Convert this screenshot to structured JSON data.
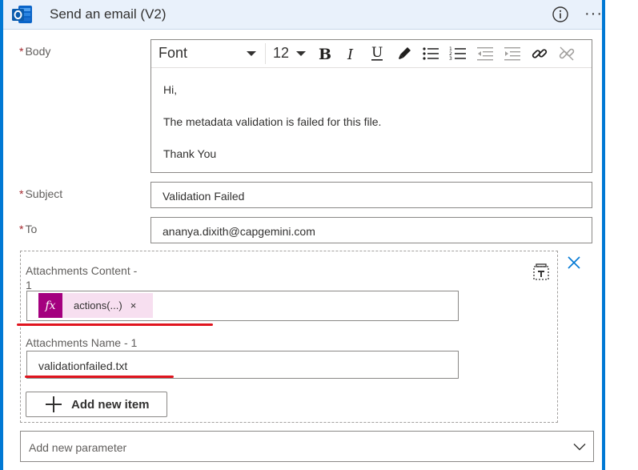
{
  "header": {
    "title": "Send an email (V2)",
    "app_icon": "outlook-icon",
    "info_icon": "info-icon",
    "more_icon": "more-options-icon",
    "more_glyph": "···",
    "accent_color": "#0078d4",
    "header_bg": "#e9f1fb"
  },
  "fields": {
    "required_mark": "*",
    "body_label": "Body",
    "subject_label": "Subject",
    "subject_value": "Validation Failed",
    "to_label": "To",
    "to_value": "ananya.dixith@capgemini.com"
  },
  "editor": {
    "font_name": "Font",
    "font_size": "12",
    "toolbar_icons": [
      "bold-icon",
      "italic-icon",
      "underline-icon",
      "highlight-icon",
      "bulleted-list-icon",
      "numbered-list-icon",
      "decrease-indent-icon",
      "increase-indent-icon",
      "link-icon",
      "unlink-icon"
    ],
    "body_lines": [
      "Hi,",
      "The metadata validation is failed for this file.",
      "Thank You"
    ]
  },
  "attachments": {
    "content_label": "Attachments Content - 1",
    "content_label_line1": "Attachments Content -",
    "content_label_line2": "1",
    "token_icon": "fx",
    "token_label": "actions(...)",
    "token_remove": "×",
    "token_color": "#a4007f",
    "name_label": "Attachments Name - 1",
    "name_value": "validationfailed.txt",
    "add_item_label": "Add new item",
    "annotation_color": "#e0141e"
  },
  "parameter": {
    "placeholder": "Add new parameter"
  }
}
